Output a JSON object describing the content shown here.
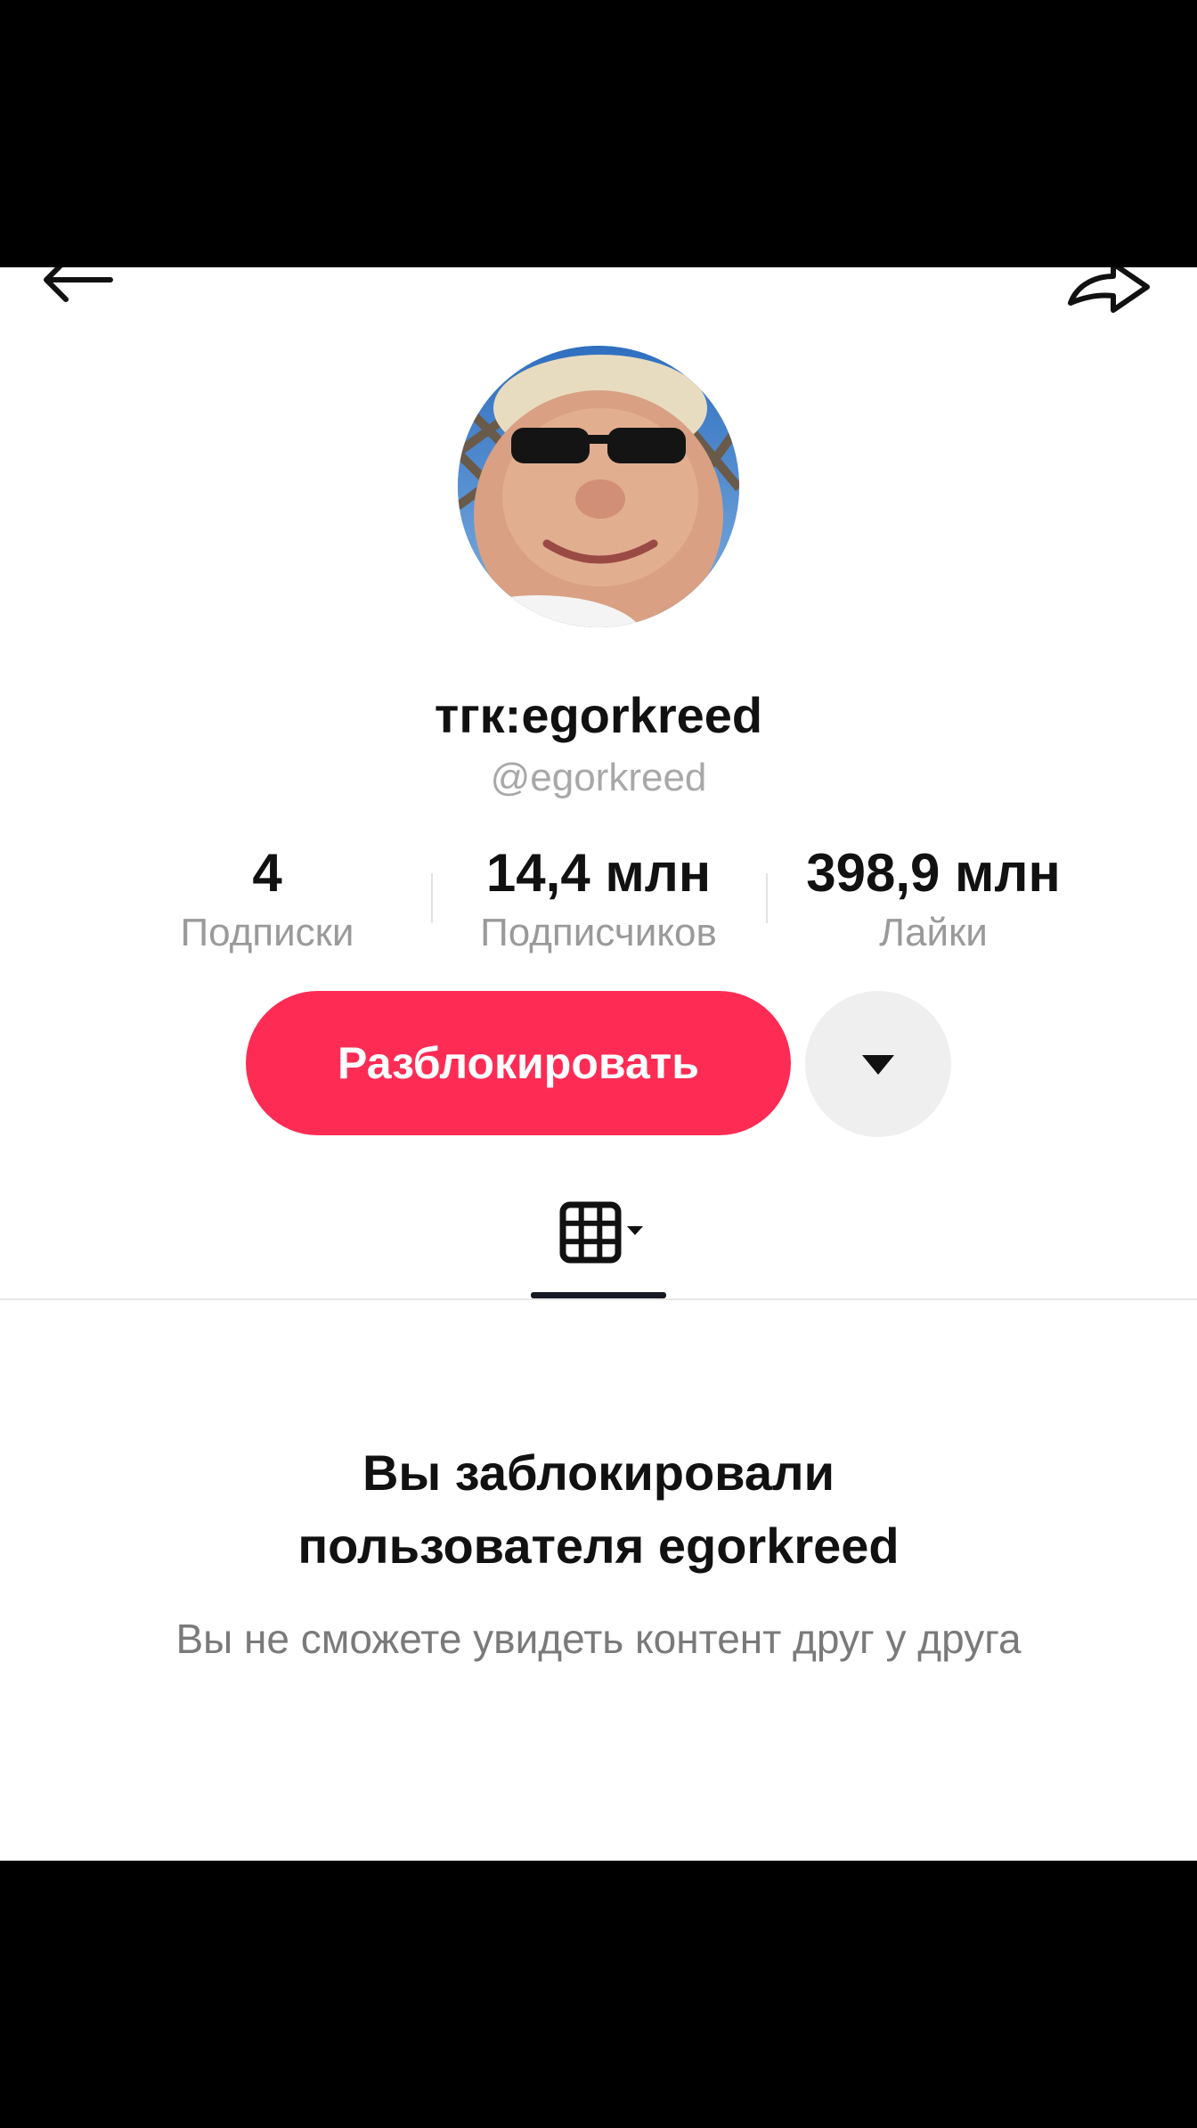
{
  "header": {
    "back_icon": "arrow-left-icon",
    "share_icon": "share-arrow-icon"
  },
  "profile": {
    "nickname": "тгк:egorkreed",
    "username": "@egorkreed",
    "avatar_icon": "avatar-photo"
  },
  "stats": [
    {
      "value": "4",
      "label": "Подписки"
    },
    {
      "value": "14,4 млн",
      "label": "Подписчиков"
    },
    {
      "value": "398,9 млн",
      "label": "Лайки"
    }
  ],
  "actions": {
    "unblock_label": "Разблокировать",
    "unblock_color": "#fe2c55",
    "dropdown_icon": "triangle-down-icon"
  },
  "tabs": {
    "grid_icon": "grid-icon"
  },
  "blocked": {
    "title_line1": "Вы заблокировали",
    "title_line2": "пользователя egorkreed",
    "message": "Вы не сможете увидеть контент друг у друга"
  }
}
